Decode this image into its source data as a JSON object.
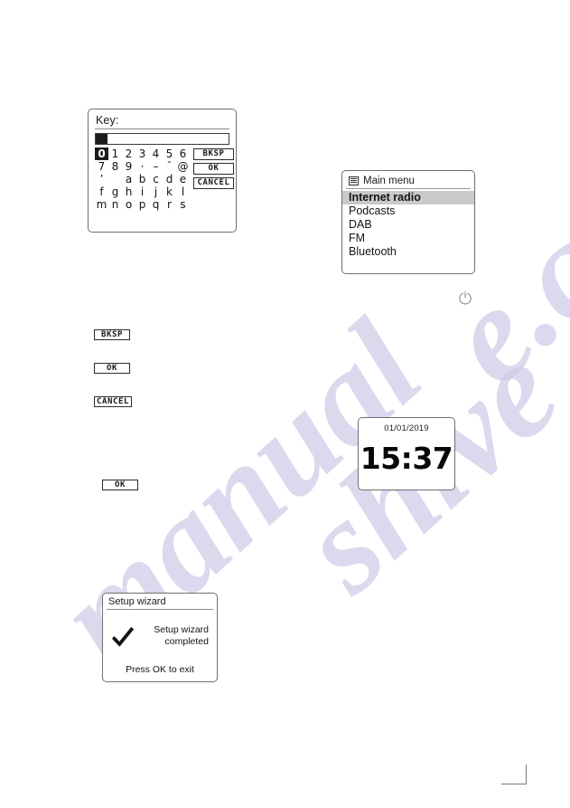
{
  "watermark": {
    "part_a": "manual",
    "part_b": "shive",
    "part_c": "e.com"
  },
  "key_panel": {
    "title": "Key:",
    "input_value": "",
    "keyboard_rows": [
      [
        "0",
        "1",
        "2",
        "3",
        "4",
        "5",
        "6"
      ],
      [
        "7",
        "8",
        "9",
        "·",
        "–",
        "¯",
        "@"
      ],
      [
        "’",
        "",
        "a",
        "b",
        "c",
        "d",
        "e"
      ],
      [
        "f",
        "g",
        "h",
        "i",
        "j",
        "k",
        "l"
      ],
      [
        "m",
        "n",
        "o",
        "p",
        "q",
        "r",
        "s"
      ]
    ],
    "selected_key": "0",
    "buttons": {
      "bksp": "BKSP",
      "ok": "OK",
      "cancel": "CANCEL"
    }
  },
  "standalone_buttons": {
    "bksp": "BKSP",
    "ok_1": "OK",
    "cancel": "CANCEL",
    "ok_2": "OK"
  },
  "main_menu": {
    "header": "Main menu",
    "header_icon": "list-menu-icon",
    "items": [
      {
        "label": "Internet radio",
        "selected": true
      },
      {
        "label": "Podcasts",
        "selected": false
      },
      {
        "label": "DAB",
        "selected": false
      },
      {
        "label": "FM",
        "selected": false
      },
      {
        "label": "Bluetooth",
        "selected": false
      }
    ]
  },
  "power_icon": {
    "name": "standby-power-icon"
  },
  "clock": {
    "date": "01/01/2019",
    "time": "15:37"
  },
  "setup_wizard": {
    "title": "Setup wizard",
    "icon": "checkmark-icon",
    "message_line1": "Setup wizard",
    "message_line2": "completed",
    "footer": "Press OK to exit"
  },
  "colors": {
    "panel_border": "#6f6f6f",
    "highlight": "#c9c9c9",
    "text": "#141414",
    "watermark": "#cdcbe8"
  }
}
